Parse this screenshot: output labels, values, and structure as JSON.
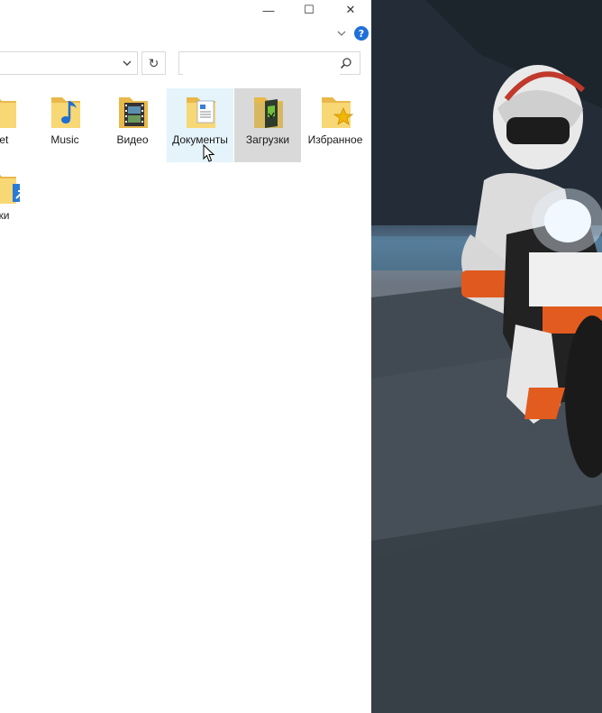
{
  "window": {
    "controls": {
      "minimize": "—",
      "maximize": "☐",
      "close": "✕"
    },
    "help_label": "?",
    "refresh_label": "↻"
  },
  "search": {
    "value": "",
    "placeholder": ""
  },
  "items": [
    {
      "label": "net",
      "icon": "folder-icon"
    },
    {
      "label": "Music",
      "icon": "music-folder-icon"
    },
    {
      "label": "Видео",
      "icon": "video-folder-icon"
    },
    {
      "label": "Документы",
      "icon": "documents-folder-icon",
      "state": "hover"
    },
    {
      "label": "Загрузки",
      "icon": "downloads-folder-icon",
      "state": "selected"
    },
    {
      "label": "Избранное",
      "icon": "favorites-folder-icon"
    },
    {
      "label": "лки",
      "icon": "shortcut-icon"
    }
  ],
  "colors": {
    "folder": "#f8d775",
    "folder_dark": "#e8b94a",
    "hover": "#e5f3fb",
    "selected": "#d9d9d9",
    "accent": "#1e6fd9"
  }
}
